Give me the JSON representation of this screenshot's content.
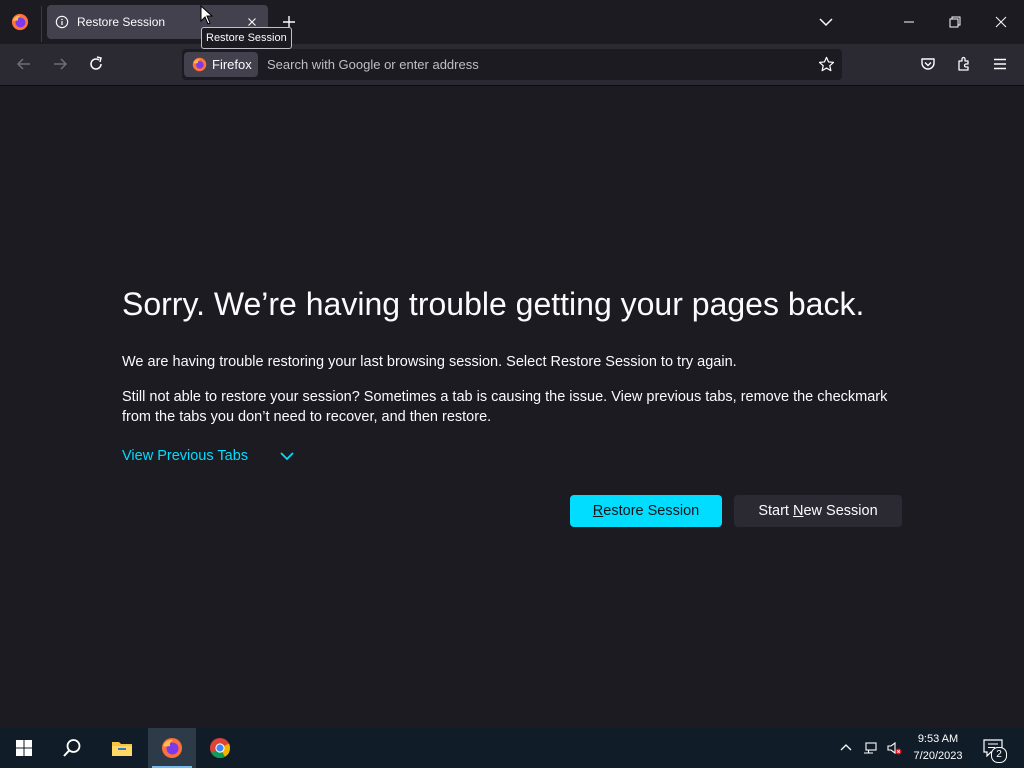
{
  "browser": {
    "tab": {
      "title": "Restore Session",
      "tooltip": "Restore Session"
    },
    "identity_label": "Firefox",
    "url_placeholder": "Search with Google or enter address"
  },
  "page": {
    "heading": "Sorry. We’re having trouble getting your pages back.",
    "paragraph1": "We are having trouble restoring your last browsing session. Select Restore Session to try again.",
    "paragraph2": "Still not able to restore your session? Sometimes a tab is causing the issue. View previous tabs, remove the checkmark from the tabs you don’t need to recover, and then restore.",
    "view_previous_tabs": "View Previous Tabs",
    "restore_button": {
      "accesskey": "R",
      "rest": "estore Session"
    },
    "new_session_button": {
      "before": "Start ",
      "accesskey": "N",
      "after": "ew Session"
    }
  },
  "taskbar": {
    "time": "9:53 AM",
    "date": "7/20/2023",
    "notification_count": "2",
    "items": [
      "start-icon",
      "search-icon",
      "file-explorer-icon",
      "firefox-icon",
      "chrome-icon"
    ]
  },
  "colors": {
    "accent": "#00ddff",
    "page_background": "#1c1b22",
    "toolbar": "#2b2a33",
    "taskbar": "#101c27"
  }
}
